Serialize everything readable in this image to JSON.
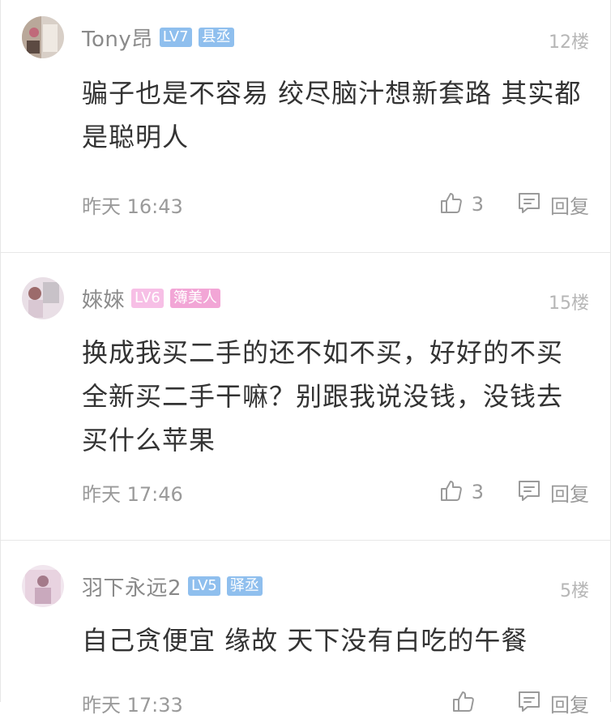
{
  "comments": [
    {
      "username": "Tony昂",
      "level": "LV7",
      "title": "县丞",
      "level_color": "#8fbfee",
      "title_color": "#8fbfee",
      "floor": "12楼",
      "content": "骗子也是不容易 绞尽脑汁想新套路 其实都是聪明人",
      "time": "昨天 16:43",
      "likes": "3",
      "reply_label": "回复",
      "icons": [
        "thumbs-up-icon",
        "reply-icon"
      ]
    },
    {
      "username": "婡婡",
      "level": "LV6",
      "title": "簿美人",
      "level_color": "#f7bfe6",
      "title_color": "#f2a6d6",
      "floor": "15楼",
      "content": "换成我买二手的还不如不买，好好的不买全新买二手干嘛？别跟我说没钱，没钱去买什么苹果",
      "time": "昨天 17:46",
      "likes": "3",
      "reply_label": "回复",
      "icons": [
        "thumbs-up-icon",
        "reply-icon"
      ]
    },
    {
      "username": "羽下永远2",
      "level": "LV5",
      "title": "驿丞",
      "level_color": "#8fbfee",
      "title_color": "#8fbfee",
      "floor": "5楼",
      "content": "自己贪便宜 缘故 天下没有白吃的午餐",
      "time": "昨天 17:33",
      "likes": "",
      "reply_label": "回复",
      "icons": [
        "thumbs-up-icon",
        "reply-icon"
      ]
    }
  ]
}
